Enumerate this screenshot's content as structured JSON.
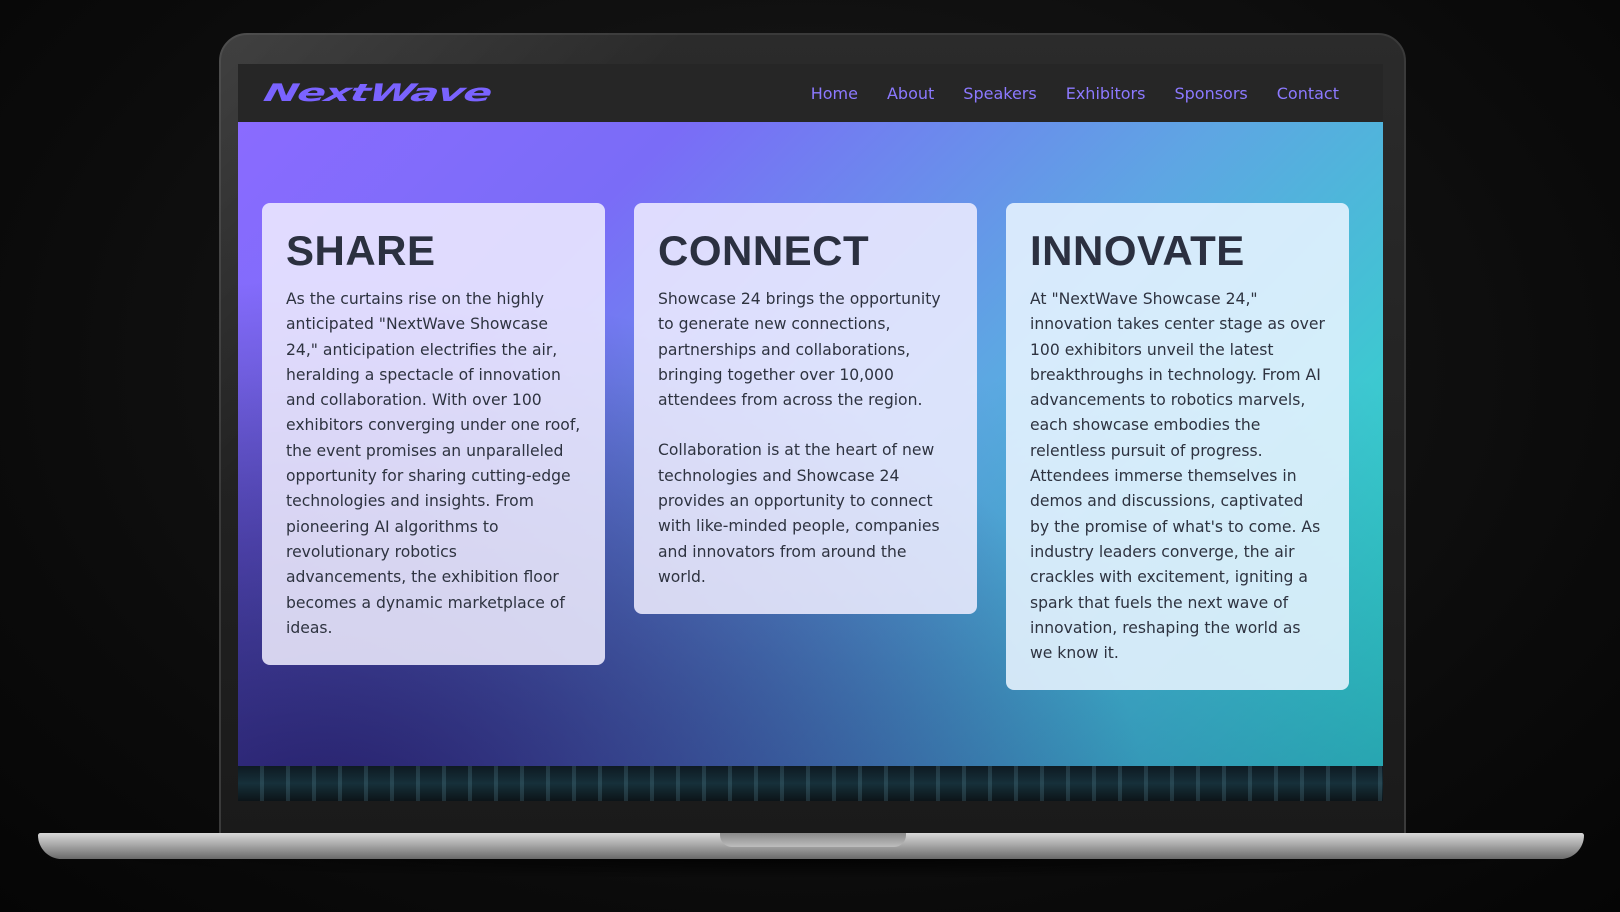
{
  "brand": {
    "logo_text": "NextWave",
    "accent": "#7a63ff"
  },
  "nav": {
    "links": [
      "Home",
      "About",
      "Speakers",
      "Exhibitors",
      "Sponsors",
      "Contact"
    ],
    "link_color": "#8c79ff"
  },
  "cards": [
    {
      "title": "SHARE",
      "paragraphs": [
        "As the curtains rise on the highly anticipated \"NextWave Showcase 24,\" anticipation electrifies the air, heralding a spectacle of innovation and collaboration. With over 100 exhibitors converging under one roof, the event promises an unparalleled opportunity for sharing cutting-edge technologies and insights. From pioneering AI algorithms to revolutionary robotics advancements, the exhibition floor becomes a dynamic marketplace of ideas."
      ]
    },
    {
      "title": "CONNECT",
      "paragraphs": [
        "Showcase 24 brings the opportunity to generate new connections, partnerships and collaborations, bringing together over 10,000 attendees from across the region.",
        "Collaboration is at the heart of new technologies and Showcase 24 provides an opportunity to connect with like-minded people, companies and innovators from around the world."
      ]
    },
    {
      "title": "INNOVATE",
      "paragraphs": [
        "At \"NextWave Showcase 24,\" innovation takes center stage as over 100 exhibitors unveil the latest breakthroughs in technology. From AI advancements to robotics marvels, each showcase embodies the relentless pursuit of progress. Attendees immerse themselves in demos and discussions, captivated by the promise of what's to come. As industry leaders converge, the air crackles with excitement, igniting a spark that fuels the next wave of innovation, reshaping the world as we know it."
      ]
    }
  ],
  "colors": {
    "gradient_start": "#8a6bff",
    "gradient_end": "#1de9bf",
    "card_text": "#2e3340"
  }
}
